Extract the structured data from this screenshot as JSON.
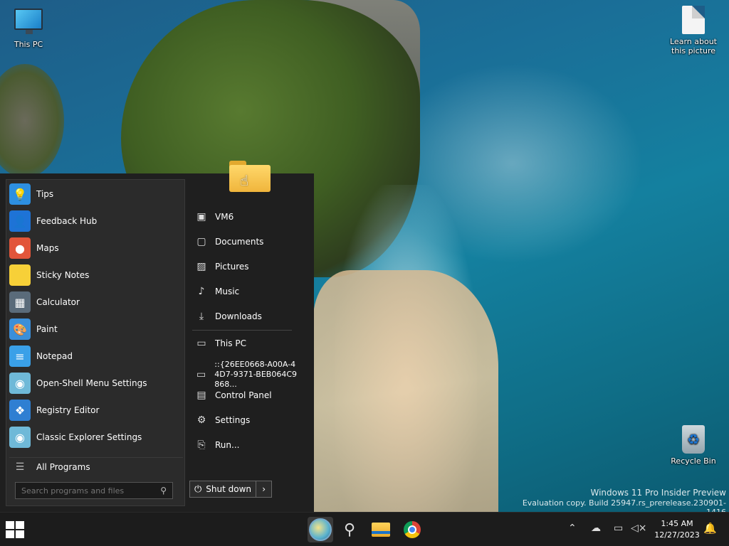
{
  "desktop": {
    "icons": {
      "this_pc": "This PC",
      "learn": "Learn about this picture",
      "recycle": "Recycle Bin"
    },
    "watermark": {
      "line1": "Windows 11 Pro Insider Preview",
      "line2": "Evaluation copy. Build 25947.rs_prerelease.230901-1416"
    }
  },
  "start_menu": {
    "programs": [
      {
        "label": "Tips",
        "icon": "lightbulb-icon",
        "color": "#2d8fe0"
      },
      {
        "label": "Feedback Hub",
        "icon": "feedback-icon",
        "color": "#1e73d6"
      },
      {
        "label": "Maps",
        "icon": "map-pin-icon",
        "color": "#e2553a"
      },
      {
        "label": "Sticky Notes",
        "icon": "sticky-note-icon",
        "color": "#f7d038"
      },
      {
        "label": "Calculator",
        "icon": "calculator-icon",
        "color": "#5a6b7a"
      },
      {
        "label": "Paint",
        "icon": "palette-icon",
        "color": "#3b8fd9"
      },
      {
        "label": "Notepad",
        "icon": "notepad-icon",
        "color": "#3aa0e8"
      },
      {
        "label": "Open-Shell Menu Settings",
        "icon": "shell-icon",
        "color": "#6fb9d8"
      },
      {
        "label": "Registry Editor",
        "icon": "registry-icon",
        "color": "#2f7fd2"
      },
      {
        "label": "Classic Explorer Settings",
        "icon": "shell-icon",
        "color": "#6fb9d8"
      }
    ],
    "all_programs": "All Programs",
    "search_placeholder": "Search programs and files",
    "right_items": [
      {
        "label": "VM6",
        "icon": "user-folder-icon"
      },
      {
        "label": "Documents",
        "icon": "document-icon"
      },
      {
        "label": "Pictures",
        "icon": "picture-icon"
      },
      {
        "label": "Music",
        "icon": "music-icon"
      },
      {
        "label": "Downloads",
        "icon": "download-icon"
      },
      {
        "label": "This PC",
        "icon": "computer-icon"
      },
      {
        "label": "::{26EE0668-A00A-44D7-9371-BEB064C9868...",
        "icon": "network-computer-icon"
      },
      {
        "label": "Control Panel",
        "icon": "control-panel-icon"
      },
      {
        "label": "Settings",
        "icon": "gear-icon"
      },
      {
        "label": "Run...",
        "icon": "run-icon"
      }
    ],
    "shutdown": "Shut down"
  },
  "taskbar": {
    "time": "1:45 AM",
    "date": "12/27/2023"
  }
}
